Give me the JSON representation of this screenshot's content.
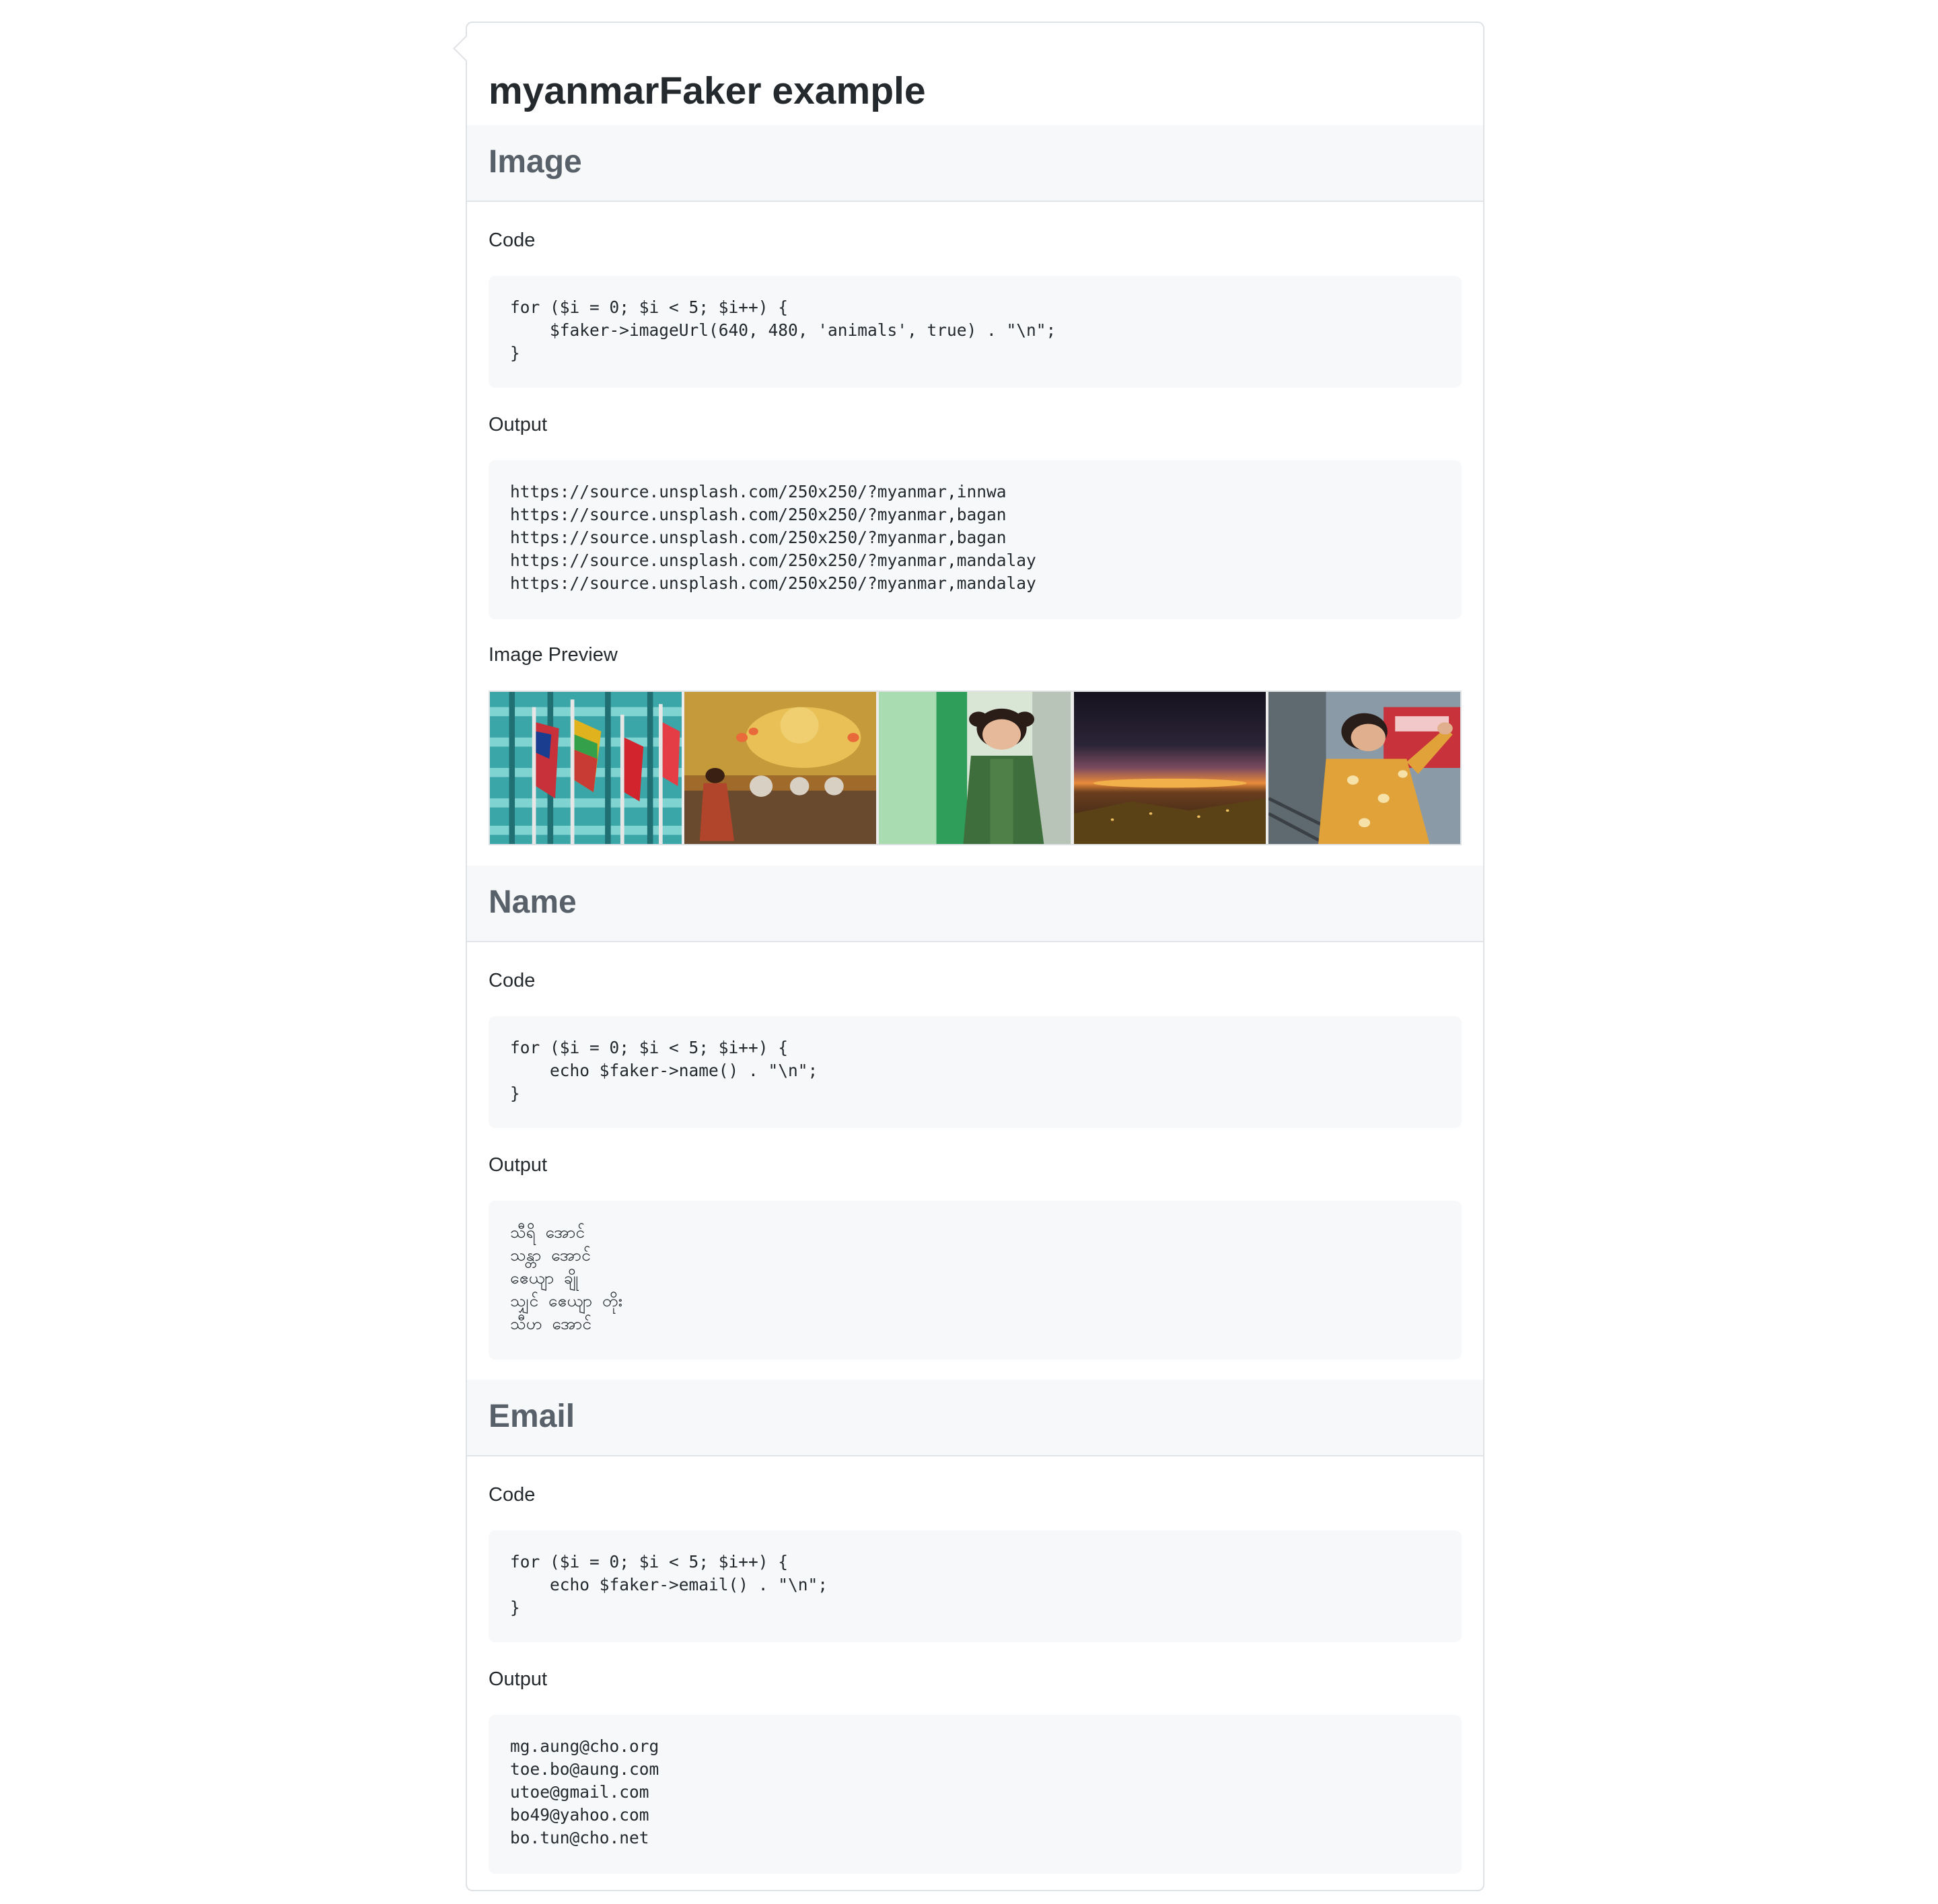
{
  "page_title": "myanmarFaker example",
  "sections": [
    {
      "title": "Image",
      "code_label": "Code",
      "code": "for ($i = 0; $i < 5; $i++) {\n    $faker->imageUrl(640, 480, 'animals', true) . \"\\n\";\n}",
      "output_label": "Output",
      "output": "https://source.unsplash.com/250x250/?myanmar,innwa\nhttps://source.unsplash.com/250x250/?myanmar,bagan\nhttps://source.unsplash.com/250x250/?myanmar,bagan\nhttps://source.unsplash.com/250x250/?myanmar,mandalay\nhttps://source.unsplash.com/250x250/?myanmar,mandalay",
      "preview_label": "Image Preview",
      "previews": [
        "flags-photo",
        "temple-photo",
        "child-photo",
        "sunset-photo",
        "woman-photo"
      ]
    },
    {
      "title": "Name",
      "code_label": "Code",
      "code": "for ($i = 0; $i < 5; $i++) {\n    echo $faker->name() . \"\\n\";\n}",
      "output_label": "Output",
      "output": "သီရိ အောင်\nသန္တာ အောင်\nဧေယျာ ချို\nသျှင် ဧေယျာ တိုး\nသီဟ အောင်"
    },
    {
      "title": "Email",
      "code_label": "Code",
      "code": "for ($i = 0; $i < 5; $i++) {\n    echo $faker->email() . \"\\n\";\n}",
      "output_label": "Output",
      "output": "mg.aung@cho.org\ntoe.bo@aung.com\nutoe@gmail.com\nbo49@yahoo.com\nbo.tun@cho.net"
    }
  ]
}
